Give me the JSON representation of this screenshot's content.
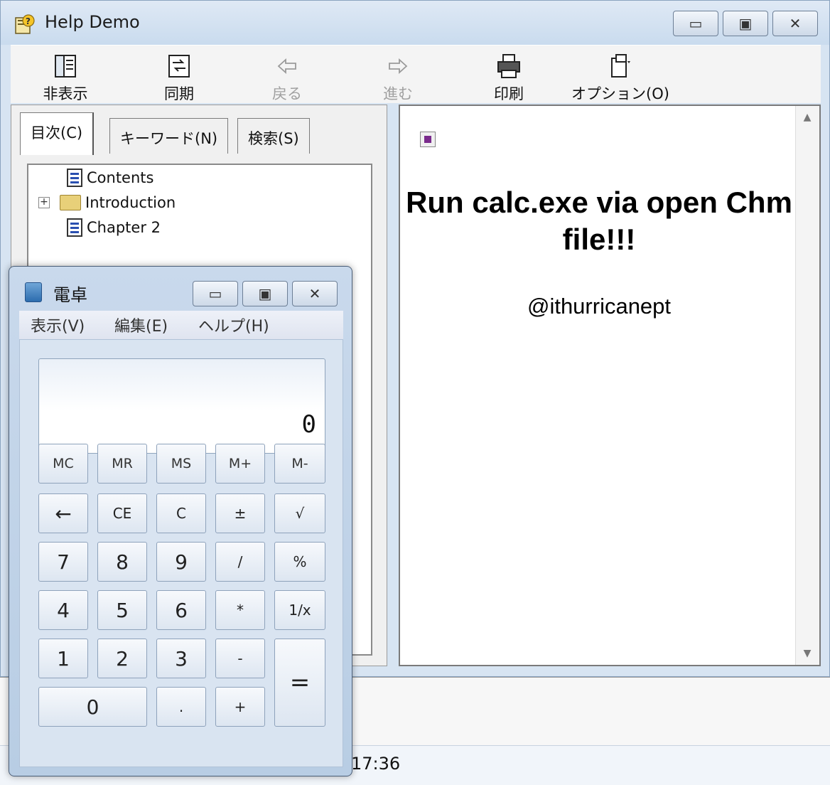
{
  "help_window": {
    "title": "Help Demo",
    "controls": {
      "minimize": "▭",
      "maximize": "▣",
      "close": "✕"
    },
    "toolbar": [
      {
        "label": "非表示",
        "icon": "hide-pane-icon",
        "enabled": true
      },
      {
        "label": "同期",
        "icon": "sync-icon",
        "enabled": true
      },
      {
        "label": "戻る",
        "icon": "back-arrow-icon",
        "enabled": false
      },
      {
        "label": "進む",
        "icon": "forward-arrow-icon",
        "enabled": false
      },
      {
        "label": "印刷",
        "icon": "printer-icon",
        "enabled": true
      },
      {
        "label": "オプション(O)",
        "icon": "options-icon",
        "enabled": true
      }
    ],
    "tabs": [
      "目次(C)",
      "キーワード(N)",
      "検索(S)"
    ],
    "tree": [
      {
        "label": "Contents",
        "icon": "document-icon"
      },
      {
        "label": "Introduction",
        "icon": "folder-icon",
        "expander": "+"
      },
      {
        "label": "Chapter 2",
        "icon": "document-icon"
      }
    ],
    "content": {
      "heading": "Run calc.exe via open Chm file!!!",
      "author": "@ithurricanept"
    }
  },
  "background": {
    "time_text": "17:36"
  },
  "calculator": {
    "title": "電卓",
    "menu": [
      "表示(V)",
      "編集(E)",
      "ヘルプ(H)"
    ],
    "display": "0",
    "keys": {
      "mc": "MC",
      "mr": "MR",
      "ms": "MS",
      "mplus": "M+",
      "mminus": "M-",
      "back": "←",
      "ce": "CE",
      "c": "C",
      "plusminus": "±",
      "sqrt": "√",
      "k7": "7",
      "k8": "8",
      "k9": "9",
      "div": "/",
      "pct": "%",
      "k4": "4",
      "k5": "5",
      "k6": "6",
      "mul": "*",
      "recip": "1/x",
      "k1": "1",
      "k2": "2",
      "k3": "3",
      "sub": "-",
      "eq": "=",
      "k0": "0",
      "dot": ".",
      "add": "+"
    }
  }
}
